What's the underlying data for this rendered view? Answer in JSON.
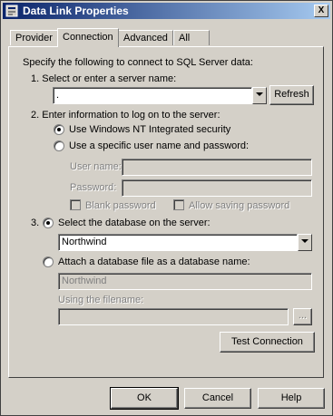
{
  "window": {
    "title": "Data Link Properties",
    "close": "X"
  },
  "tabs": [
    "Provider",
    "Connection",
    "Advanced",
    "All"
  ],
  "connection": {
    "intro": "Specify the following to connect to SQL Server data:",
    "step1": "1. Select or enter a server name:",
    "server_value": ".",
    "refresh": "Refresh",
    "step2": "2. Enter information to log on to the server:",
    "use_nt": "Use Windows NT Integrated security",
    "use_specific": "Use a specific user name and password:",
    "user_name": "User name:",
    "password": "Password:",
    "blank_password": "Blank password",
    "allow_saving": "Allow saving password",
    "step3": "3.",
    "select_db": "Select the database on the server:",
    "database": "Northwind",
    "attach": "Attach a database file as a database name:",
    "attach_name": "Northwind",
    "using_filename": "Using the filename:",
    "browse": "...",
    "test": "Test Connection"
  },
  "footer": {
    "ok": "OK",
    "cancel": "Cancel",
    "help": "Help"
  }
}
